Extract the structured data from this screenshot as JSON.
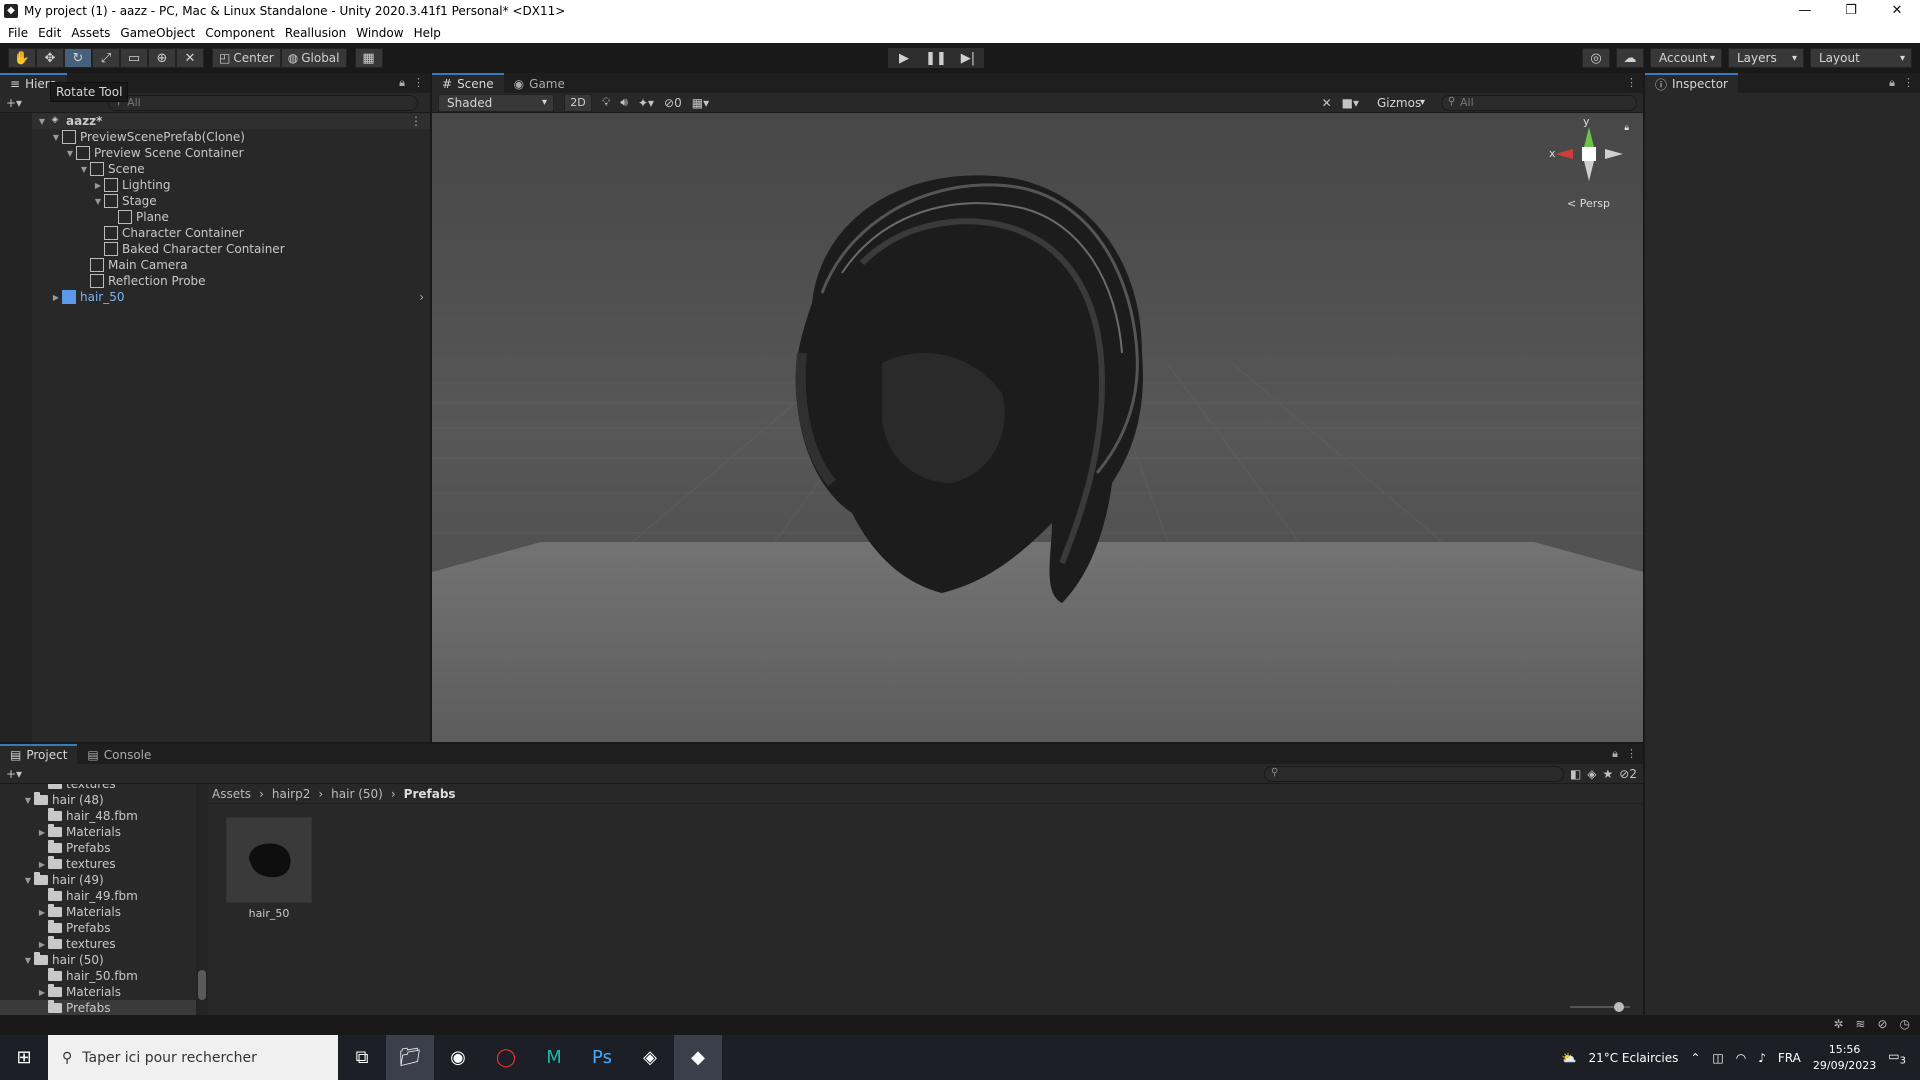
{
  "window": {
    "title": "My project (1) - aazz - PC, Mac & Linux Standalone - Unity 2020.3.41f1 Personal* <DX11>"
  },
  "menu": [
    "File",
    "Edit",
    "Assets",
    "GameObject",
    "Component",
    "Reallusion",
    "Window",
    "Help"
  ],
  "toolbar": {
    "center_label": "Center",
    "global_label": "Global",
    "tooltip": "Rotate Tool",
    "account_label": "Account",
    "layers_label": "Layers",
    "layout_label": "Layout"
  },
  "hierarchy": {
    "tab": "Hiera",
    "search_placeholder": "All",
    "items": [
      {
        "label": "aazz*",
        "depth": 0,
        "arrow": "▼",
        "icon": "scene"
      },
      {
        "label": "PreviewScenePrefab(Clone)",
        "depth": 1,
        "arrow": "▼",
        "icon": "cube"
      },
      {
        "label": "Preview Scene Container",
        "depth": 2,
        "arrow": "▼",
        "icon": "cube"
      },
      {
        "label": "Scene",
        "depth": 3,
        "arrow": "▼",
        "icon": "cube"
      },
      {
        "label": "Lighting",
        "depth": 4,
        "arrow": "▶",
        "icon": "cube"
      },
      {
        "label": "Stage",
        "depth": 4,
        "arrow": "▼",
        "icon": "cube"
      },
      {
        "label": "Plane",
        "depth": 5,
        "arrow": "",
        "icon": "cube"
      },
      {
        "label": "Character Container",
        "depth": 4,
        "arrow": "",
        "icon": "cube"
      },
      {
        "label": "Baked Character Container",
        "depth": 4,
        "arrow": "",
        "icon": "cube"
      },
      {
        "label": "Main Camera",
        "depth": 3,
        "arrow": "",
        "icon": "cube"
      },
      {
        "label": "Reflection Probe",
        "depth": 3,
        "arrow": "",
        "icon": "cube"
      },
      {
        "label": "hair_50",
        "depth": 1,
        "arrow": "▶",
        "icon": "prefab"
      }
    ]
  },
  "scene": {
    "tab_scene": "Scene",
    "tab_game": "Game",
    "shading": "Shaded",
    "mode_2d": "2D",
    "hidden_count": "0",
    "gizmos_label": "Gizmos",
    "search_placeholder": "All",
    "persp_label": "Persp",
    "axis_x": "x",
    "axis_y": "y"
  },
  "inspector": {
    "tab": "Inspector"
  },
  "project": {
    "tab_project": "Project",
    "tab_console": "Console",
    "hidden_count": "2",
    "breadcrumb": [
      "Assets",
      "hairp2",
      "hair (50)",
      "Prefabs"
    ],
    "tree": [
      {
        "label": "textures",
        "depth": 2,
        "arrow": ""
      },
      {
        "label": "hair (48)",
        "depth": 1,
        "arrow": "▼"
      },
      {
        "label": "hair_48.fbm",
        "depth": 2,
        "arrow": ""
      },
      {
        "label": "Materials",
        "depth": 2,
        "arrow": "▶"
      },
      {
        "label": "Prefabs",
        "depth": 2,
        "arrow": ""
      },
      {
        "label": "textures",
        "depth": 2,
        "arrow": "▶"
      },
      {
        "label": "hair (49)",
        "depth": 1,
        "arrow": "▼"
      },
      {
        "label": "hair_49.fbm",
        "depth": 2,
        "arrow": ""
      },
      {
        "label": "Materials",
        "depth": 2,
        "arrow": "▶"
      },
      {
        "label": "Prefabs",
        "depth": 2,
        "arrow": ""
      },
      {
        "label": "textures",
        "depth": 2,
        "arrow": "▶"
      },
      {
        "label": "hair (50)",
        "depth": 1,
        "arrow": "▼"
      },
      {
        "label": "hair_50.fbm",
        "depth": 2,
        "arrow": ""
      },
      {
        "label": "Materials",
        "depth": 2,
        "arrow": "▶"
      },
      {
        "label": "Prefabs",
        "depth": 2,
        "arrow": ""
      }
    ],
    "asset_name": "hair_50"
  },
  "taskbar": {
    "search_placeholder": "Taper ici pour rechercher",
    "weather": "21°C  Eclaircies",
    "lang": "FRA",
    "time": "15:56",
    "date": "29/09/2023",
    "notif_count": "3"
  }
}
